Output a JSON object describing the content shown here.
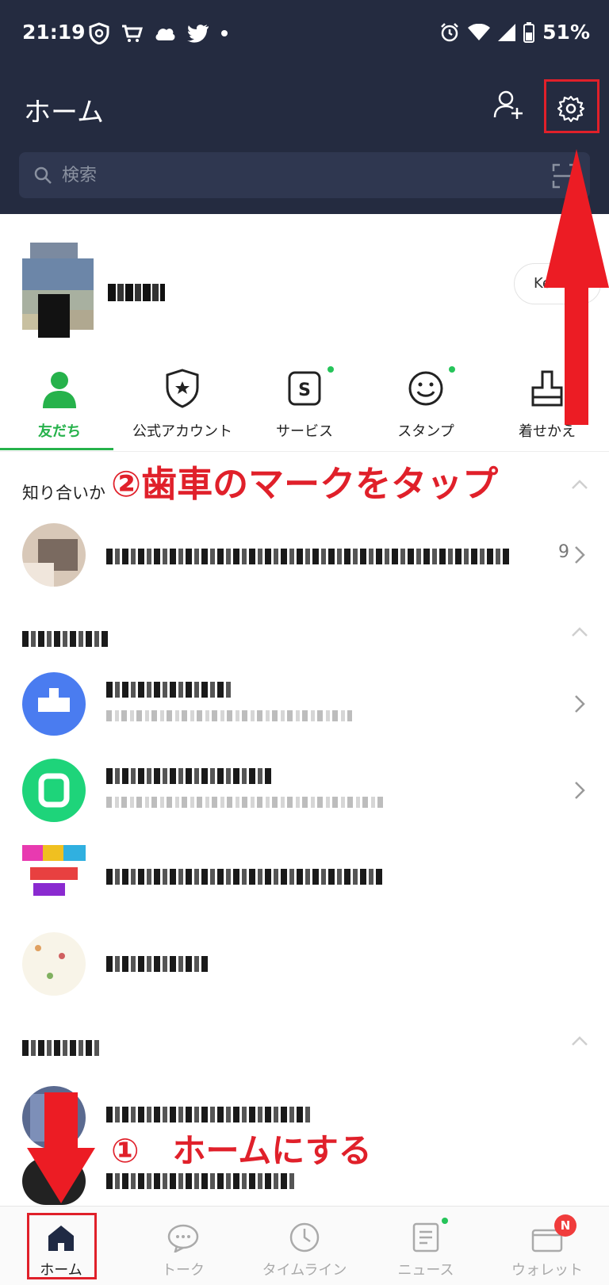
{
  "status_bar": {
    "time": "21:19",
    "battery": "51%",
    "left_icons": [
      "vpn-shield-icon",
      "cart-icon",
      "cloud-icon",
      "twitter-icon",
      "dot-icon"
    ],
    "right_icons": [
      "alarm-icon",
      "wifi-icon",
      "signal-icon",
      "battery-icon"
    ]
  },
  "header": {
    "title": "ホーム",
    "search_placeholder": "検索",
    "add_friend_icon": "add-friend-icon",
    "settings_icon": "gear-icon",
    "scan_icon": "qr-scan-icon"
  },
  "profile": {
    "pill_label": "Ke"
  },
  "tabs": [
    {
      "label": "友だち",
      "icon": "friends-icon",
      "active": true
    },
    {
      "label": "公式アカウント",
      "icon": "official-account-icon",
      "active": false
    },
    {
      "label": "サービス",
      "icon": "service-icon",
      "active": false,
      "dot": true
    },
    {
      "label": "スタンプ",
      "icon": "sticker-icon",
      "active": false,
      "dot": true
    },
    {
      "label": "着せかえ",
      "icon": "theme-icon",
      "active": false
    }
  ],
  "sections": {
    "acquaintance": {
      "title": "知り合いか",
      "count": "9"
    }
  },
  "annotations": {
    "step2": "②歯車のマークをタップ",
    "step1": "①　ホームにする"
  },
  "bottom_nav": [
    {
      "label": "ホーム",
      "icon": "home-icon",
      "active": true
    },
    {
      "label": "トーク",
      "icon": "chat-icon",
      "active": false
    },
    {
      "label": "タイムライン",
      "icon": "timeline-icon",
      "active": false
    },
    {
      "label": "ニュース",
      "icon": "news-icon",
      "active": false,
      "dot": true
    },
    {
      "label": "ウォレット",
      "icon": "wallet-icon",
      "active": false,
      "badge": "N"
    }
  ],
  "colors": {
    "header_bg": "#242b40",
    "accent_green": "#26b24b",
    "annotation_red": "#e0202a"
  }
}
